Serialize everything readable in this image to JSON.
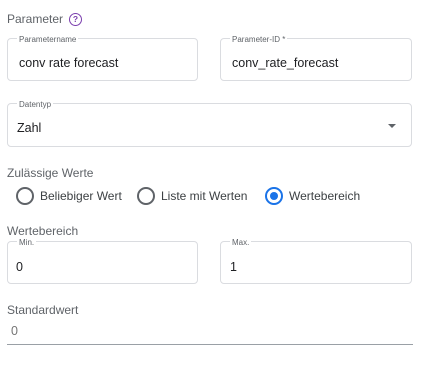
{
  "parameter_header": {
    "label": "Parameter",
    "help_icon_glyph": "?"
  },
  "fields": {
    "parameter_name": {
      "label": "Parametername",
      "value": "conv rate forecast"
    },
    "parameter_id": {
      "label": "Parameter-ID *",
      "value": "conv_rate_forecast"
    },
    "data_type": {
      "label": "Datentyp",
      "value": "Zahl"
    }
  },
  "allowed_values": {
    "label": "Zulässige Werte",
    "options": [
      {
        "label": "Beliebiger Wert",
        "checked": false
      },
      {
        "label": "Liste mit Werten",
        "checked": false
      },
      {
        "label": "Wertebereich",
        "checked": true
      }
    ]
  },
  "value_range": {
    "label": "Wertebereich",
    "min": {
      "label": "Min.",
      "value": "0"
    },
    "max": {
      "label": "Max.",
      "value": "1"
    }
  },
  "default_value": {
    "label": "Standardwert",
    "value": "0"
  },
  "colors": {
    "accent": "#1a73e8",
    "help_icon": "#7b3fae",
    "border": "#dadce0"
  }
}
